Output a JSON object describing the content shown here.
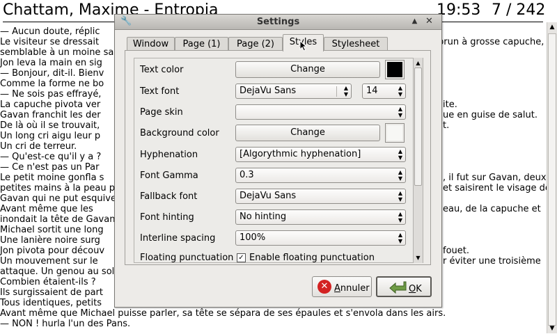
{
  "reader": {
    "title": "Chattam, Maxime - Entropia",
    "clock": "19:53",
    "page": "7 / 242",
    "lines_left": [
      "    — Aucun doute, réplic",
      "    Le visiteur se dressait",
      "semblable à un moine sar",
      "    Jon leva la main en sig",
      "    — Bonjour, dit-il. Bienv",
      "    Comme la forme ne bo",
      "    — Ne sois pas effrayé,",
      "    La capuche pivota ver",
      "    Gavan franchit les der",
      "    De là où il se trouvait,",
      "    Un long cri aigu leur p",
      "    Un cri de terreur.",
      "    — Qu'est-ce qu'il y a ?",
      "    — Ce n'est pas un Par",
      "    Le petit moine gonfla s",
      "petites mains à la peau p",
      "Gavan qui ne put esquive",
      "    Avant même que les",
      "inondait la tête de Gavan",
      "    Michael sortit une long",
      "    Une lanière noire surg",
      "    Jon pivota pour découv",
      "    Un mouvement sur le",
      "attaque. Un genou au sol",
      "    Combien étaient-ils ?",
      "    Ils surgissaient de part",
      "    Tous identiques, petits",
      "    Avant même que Michael puisse parler, sa tête se sépara de ses épaules et s'envola dans les airs.",
      "    — NON ! hurla l'un des Pans."
    ],
    "lines_right": [
      "brun à grosse capuche,",
      "ite.",
      "ue en guise de salut.",
      "t.",
      ", il fut sur Gavan, deux",
      "et saisirent le visage de",
      "eau, de la capuche et",
      "fouet.",
      "r éviter une troisième"
    ]
  },
  "dialog": {
    "title": "Settings",
    "tabs": [
      "Window",
      "Page (1)",
      "Page (2)",
      "Styles",
      "Stylesheet"
    ],
    "active_tab": "Styles",
    "rows": {
      "text_color": {
        "label": "Text color",
        "button": "Change",
        "swatch": "#000000"
      },
      "text_font": {
        "label": "Text font",
        "value": "DejaVu Sans",
        "size": "14"
      },
      "page_skin": {
        "label": "Page skin",
        "value": ""
      },
      "background_color": {
        "label": "Background color",
        "button": "Change",
        "swatch": "#f7f7f5"
      },
      "hyphenation": {
        "label": "Hyphenation",
        "value": "[Algorythmic hyphenation]"
      },
      "font_gamma": {
        "label": "Font Gamma",
        "value": "0.3"
      },
      "fallback_font": {
        "label": "Fallback font",
        "value": "DejaVu Sans"
      },
      "font_hinting": {
        "label": "Font hinting",
        "value": "No hinting"
      },
      "interline_spacing": {
        "label": "Interline spacing",
        "value": "100%"
      },
      "floating_punctuation": {
        "label": "Floating punctuation",
        "checkbox": "Enable floating punctuation",
        "checked": true
      }
    },
    "buttons": {
      "cancel_label_underlined": "A",
      "cancel_label_rest": "nnuler",
      "ok_label_underlined": "O",
      "ok_label_rest": "K"
    }
  }
}
